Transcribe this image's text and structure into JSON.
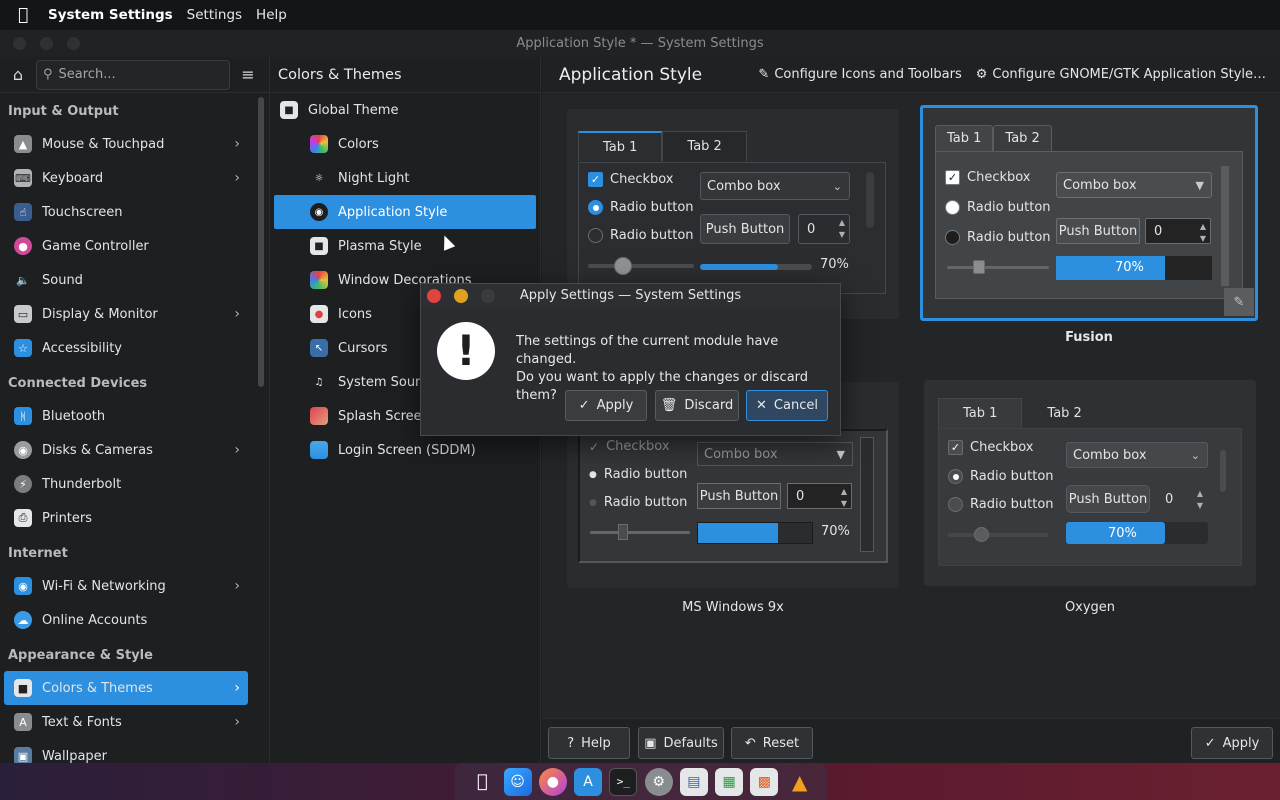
{
  "menubar": {
    "app_name": "System Settings",
    "menus": [
      "Settings",
      "Help"
    ]
  },
  "window": {
    "title": "Application Style * — System Settings"
  },
  "sidebar": {
    "search_placeholder": "Search...",
    "sections": [
      {
        "label": "Input & Output",
        "items": [
          {
            "label": "Mouse & Touchpad",
            "chevron": true
          },
          {
            "label": "Keyboard",
            "chevron": true
          },
          {
            "label": "Touchscreen",
            "chevron": false
          },
          {
            "label": "Game Controller",
            "chevron": false
          },
          {
            "label": "Sound",
            "chevron": false
          },
          {
            "label": "Display & Monitor",
            "chevron": true
          },
          {
            "label": "Accessibility",
            "chevron": false
          }
        ]
      },
      {
        "label": "Connected Devices",
        "items": [
          {
            "label": "Bluetooth",
            "chevron": false
          },
          {
            "label": "Disks & Cameras",
            "chevron": true
          },
          {
            "label": "Thunderbolt",
            "chevron": false
          },
          {
            "label": "Printers",
            "chevron": false
          }
        ]
      },
      {
        "label": "Internet",
        "items": [
          {
            "label": "Wi-Fi & Networking",
            "chevron": true
          },
          {
            "label": "Online Accounts",
            "chevron": false
          }
        ]
      },
      {
        "label": "Appearance & Style",
        "items": [
          {
            "label": "Colors & Themes",
            "chevron": true,
            "active": true
          },
          {
            "label": "Text & Fonts",
            "chevron": true
          },
          {
            "label": "Wallpaper",
            "chevron": false
          }
        ]
      }
    ]
  },
  "middle": {
    "title": "Colors & Themes",
    "root": "Global Theme",
    "items": [
      "Colors",
      "Night Light",
      "Application Style",
      "Plasma Style",
      "Window Decorations",
      "Icons",
      "Cursors",
      "System Sounds",
      "Splash Screen",
      "Login Screen (SDDM)"
    ],
    "active": "Application Style"
  },
  "content": {
    "title": "Application Style",
    "configure_icons": "Configure Icons and Toolbars",
    "configure_gtk": "Configure GNOME/GTK Application Style…",
    "preview_widgets": {
      "tab1": "Tab 1",
      "tab2": "Tab 2",
      "checkbox": "Checkbox",
      "radio": "Radio button",
      "combo": "Combo box",
      "push": "Push Button",
      "spin": "0",
      "progress_label": "70%",
      "progress_fraction": 0.7
    },
    "styles": [
      "Fusion",
      "MS Windows 9x",
      "Oxygen"
    ]
  },
  "bottombar": {
    "help": "Help",
    "defaults": "Defaults",
    "reset": "Reset",
    "apply": "Apply"
  },
  "dialog": {
    "title": "Apply Settings — System Settings",
    "line1": "The settings of the current module have changed.",
    "line2": "Do you want to apply the changes or discard them?",
    "apply": "Apply",
    "discard": "Discard",
    "cancel": "Cancel"
  },
  "colors": {
    "accent": "#2d8fe0",
    "close": "#e0443e",
    "minimize": "#e0a020"
  }
}
